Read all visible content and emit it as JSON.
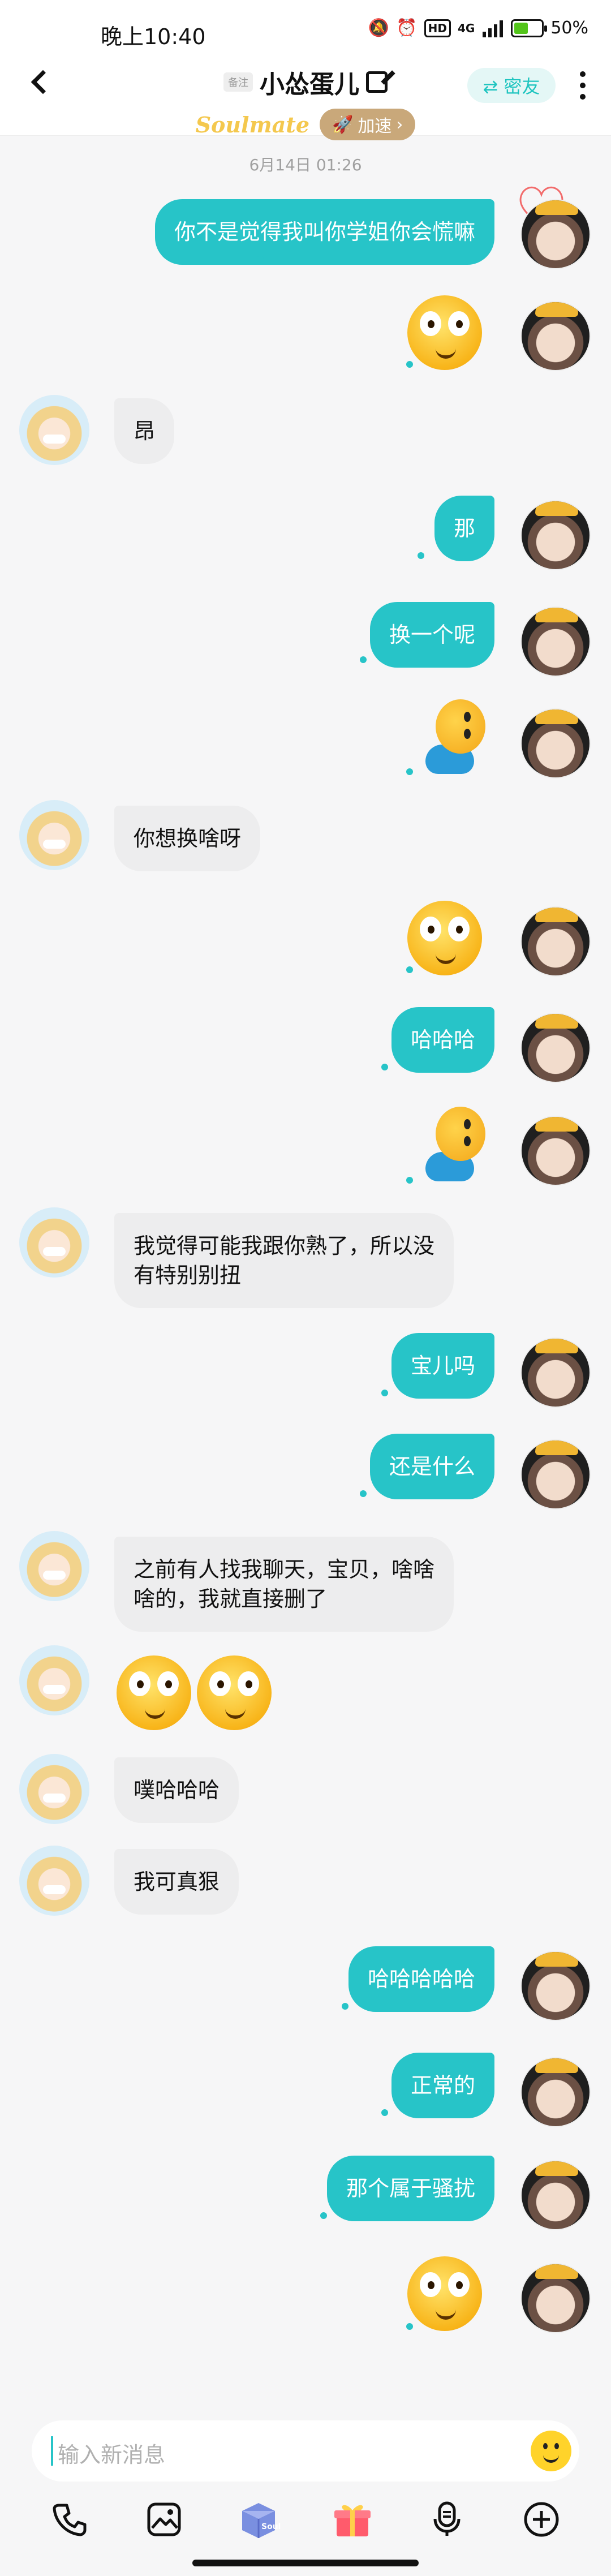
{
  "status_bar": {
    "time": "晚上10:40",
    "network": "4G",
    "hd": "HD",
    "battery": "50%"
  },
  "header": {
    "remark_tag": "备注",
    "contact_name": "小怂蛋儿",
    "intimate_label": "⇄ 密友",
    "soulmate_label": "Soulmate",
    "speedup_label": "加速"
  },
  "timestamp": "6月14日 01:26",
  "messages": [
    {
      "from": "me",
      "type": "text",
      "text": "你不是觉得我叫你学姐你会慌嘛"
    },
    {
      "from": "me",
      "type": "emoji"
    },
    {
      "from": "them",
      "type": "text",
      "text": "昂"
    },
    {
      "from": "me",
      "type": "text",
      "text": "那"
    },
    {
      "from": "me",
      "type": "text",
      "text": "换一个呢"
    },
    {
      "from": "me",
      "type": "sticker"
    },
    {
      "from": "them",
      "type": "text",
      "text": "你想换啥呀"
    },
    {
      "from": "me",
      "type": "emoji"
    },
    {
      "from": "me",
      "type": "text",
      "text": "哈哈哈"
    },
    {
      "from": "me",
      "type": "sticker"
    },
    {
      "from": "them",
      "type": "text",
      "lines": [
        "我觉得可能我跟你熟了，所以没",
        "有特别别扭"
      ]
    },
    {
      "from": "me",
      "type": "text",
      "text": "宝儿吗"
    },
    {
      "from": "me",
      "type": "text",
      "text": "还是什么"
    },
    {
      "from": "them",
      "type": "text",
      "lines": [
        "之前有人找我聊天，宝贝，啥啥",
        "啥的，我就直接删了"
      ]
    },
    {
      "from": "them",
      "type": "emoji-pair"
    },
    {
      "from": "them",
      "type": "text",
      "text": "噗哈哈哈"
    },
    {
      "from": "them",
      "type": "text",
      "text": "我可真狠"
    },
    {
      "from": "me",
      "type": "text",
      "text": "哈哈哈哈哈"
    },
    {
      "from": "me",
      "type": "text",
      "text": "正常的"
    },
    {
      "from": "me",
      "type": "text",
      "text": "那个属于骚扰"
    },
    {
      "from": "me",
      "type": "emoji"
    }
  ],
  "input": {
    "placeholder": "输入新消息"
  },
  "toolbar": [
    "phone-icon",
    "image-icon",
    "soul-box-icon",
    "gift-icon",
    "voice-icon",
    "plus-icon"
  ],
  "colors": {
    "accent": "#27c4c8",
    "bubble_them": "#ededee",
    "background": "#f6f6f7"
  }
}
